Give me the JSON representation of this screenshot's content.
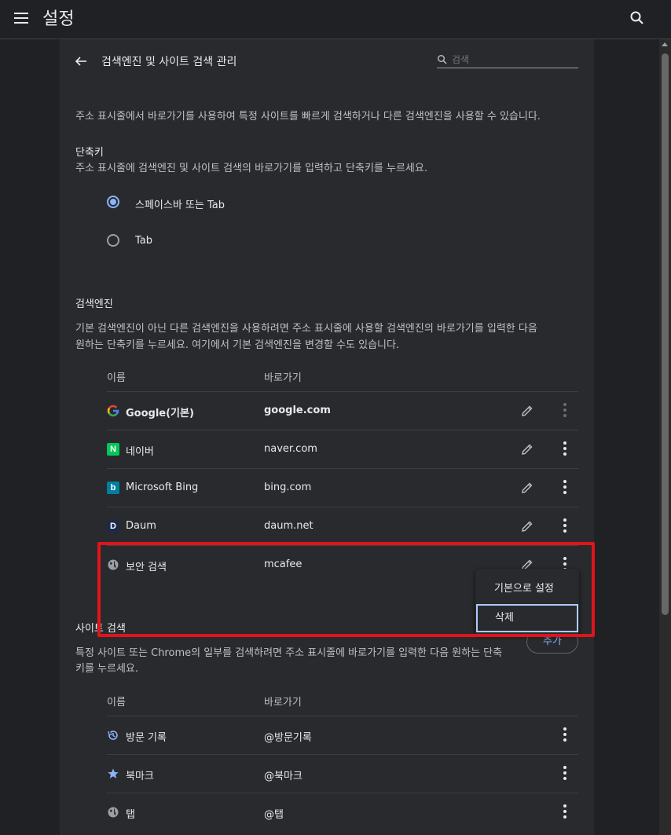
{
  "app": {
    "title": "설정"
  },
  "page": {
    "title": "검색엔진 및 사이트 검색 관리",
    "search_placeholder": "검색",
    "intro": "주소 표시줄에서 바로가기를 사용하여 특정 사이트를 빠르게 검색하거나 다른 검색엔진을 사용할 수 있습니다."
  },
  "shortcut": {
    "heading": "단축키",
    "desc": "주소 표시줄에 검색엔진 및 사이트 검색의 바로가기를 입력하고 단축키를 누르세요.",
    "options": [
      {
        "label": "스페이스바 또는 Tab",
        "checked": true
      },
      {
        "label": "Tab",
        "checked": false
      }
    ]
  },
  "engines": {
    "heading": "검색엔진",
    "desc_line1": "기본 검색엔진이 아닌 다른 검색엔진을 사용하려면 주소 표시줄에 사용할 검색엔진의 바로가기를 입력한 다음",
    "desc_line2": "원하는 단축키를 누르세요. 여기에서 기본 검색엔진을 변경할 수도 있습니다.",
    "col_name": "이름",
    "col_shortcut": "바로가기",
    "rows": [
      {
        "name": "Google(기본)",
        "shortcut": "google.com",
        "icon": "google-icon"
      },
      {
        "name": "네이버",
        "shortcut": "naver.com",
        "icon": "naver-icon",
        "badge": "N",
        "color": "#03c75a"
      },
      {
        "name": "Microsoft Bing",
        "shortcut": "bing.com",
        "icon": "bing-icon",
        "badge": "b",
        "color": "#00809d"
      },
      {
        "name": "Daum",
        "shortcut": "daum.net",
        "icon": "daum-icon",
        "badge": "D",
        "color": "#1b2a4a"
      },
      {
        "name": "보안 검색",
        "shortcut": "mcafee",
        "icon": "globe-icon"
      }
    ]
  },
  "context_menu": {
    "items": [
      "기본으로 설정",
      "삭제"
    ]
  },
  "site_search": {
    "heading": "사이트 검색",
    "add_label": "추가",
    "desc_line1": "특정 사이트 또는 Chrome의 일부를 검색하려면 주소 표시줄에 바로가기를 입력한 다음 원하는 단축",
    "desc_line2": "키를 누르세요.",
    "col_name": "이름",
    "col_shortcut": "바로가기",
    "rows": [
      {
        "name": "방문 기록",
        "shortcut": "@방문기록",
        "icon": "history-icon"
      },
      {
        "name": "북마크",
        "shortcut": "@북마크",
        "icon": "star-icon"
      },
      {
        "name": "탭",
        "shortcut": "@탭",
        "icon": "globe-icon"
      }
    ]
  },
  "colors": {
    "accent": "#8ab4f8",
    "highlight": "#e0141d"
  }
}
